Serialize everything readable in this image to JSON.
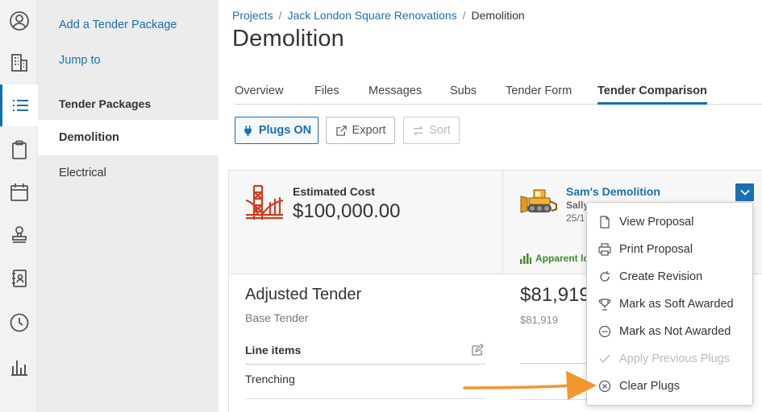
{
  "rail": {
    "icons": [
      "user-circle-icon",
      "building-icon",
      "list-icon",
      "clipboard-icon",
      "calendar-icon",
      "stamp-icon",
      "address-book-icon",
      "clock-icon",
      "bar-chart-icon"
    ],
    "active": "list-icon"
  },
  "nav": {
    "add_tender_package": "Add a Tender Package",
    "jump_to": "Jump to",
    "section_title": "Tender Packages",
    "items": [
      {
        "label": "Demolition"
      },
      {
        "label": "Electrical"
      }
    ]
  },
  "breadcrumb": {
    "items": [
      "Projects",
      "Jack London Square Renovations",
      "Demolition"
    ],
    "separator": "/"
  },
  "page_title": "Demolition",
  "tabs": [
    {
      "label": "Overview"
    },
    {
      "label": "Files"
    },
    {
      "label": "Messages"
    },
    {
      "label": "Subs"
    },
    {
      "label": "Tender Form"
    },
    {
      "label": "Tender Comparison"
    }
  ],
  "toolbar": {
    "plugs_label": "Plugs ON",
    "export_label": "Export",
    "sort_label": "Sort"
  },
  "estimate": {
    "label": "Estimated Cost",
    "value": "$100,000.00"
  },
  "bid": {
    "company": "Sam's Demolition",
    "contact_partial": "Sally",
    "date_partial": "25/1",
    "apparent_partial": "Apparent lo",
    "amount_partial": "$81,919",
    "amount_sub": "$81,919"
  },
  "adjusted": {
    "title": "Adjusted Tender",
    "subtitle": "Base Tender",
    "line_items_header": "Line items",
    "rows": [
      "Trenching"
    ]
  },
  "dropdown_menu": {
    "items": [
      {
        "label": "View Proposal",
        "icon": "document-icon",
        "enabled": true
      },
      {
        "label": "Print Proposal",
        "icon": "printer-icon",
        "enabled": true
      },
      {
        "label": "Create Revision",
        "icon": "revision-icon",
        "enabled": true
      },
      {
        "label": "Mark as Soft Awarded",
        "icon": "trophy-icon",
        "enabled": true
      },
      {
        "label": "Mark as Not Awarded",
        "icon": "minus-circle-icon",
        "enabled": true
      },
      {
        "label": "Apply Previous Plugs",
        "icon": "check-icon",
        "enabled": false
      },
      {
        "label": "Clear Plugs",
        "icon": "x-circle-icon",
        "enabled": true
      }
    ]
  },
  "colors": {
    "accent": "#1a6eb3",
    "annotation_arrow": "#f2962f",
    "apparent_low": "#3e8a2a"
  }
}
